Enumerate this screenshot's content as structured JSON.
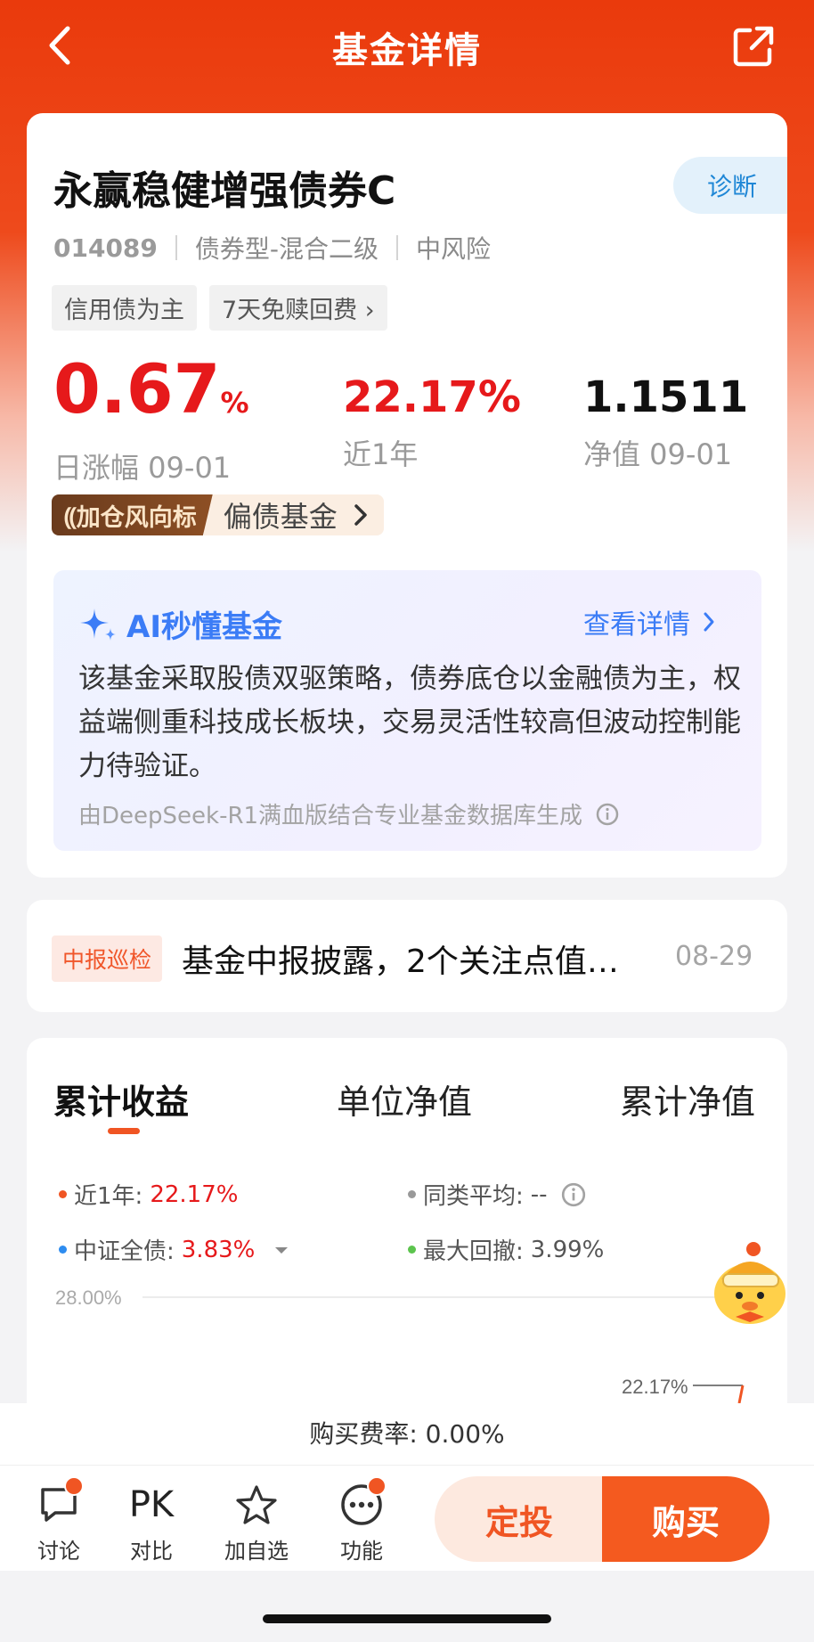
{
  "header": {
    "title": "基金详情",
    "back_icon": "chevron-left-icon",
    "share_icon": "share-icon"
  },
  "fund": {
    "name": "永赢稳健增强债券C",
    "diagnose_label": "诊断",
    "code": "014089",
    "category": "债券型-混合二级",
    "risk": "中风险",
    "tags": [
      "信用债为主",
      "7天免赎回费"
    ],
    "daily_change": {
      "value": "0.67",
      "unit": "%",
      "label": "日涨幅 09-01"
    },
    "year_return": {
      "value": "22.17%",
      "label": "近1年"
    },
    "nav": {
      "value": "1.1511",
      "label": "净值 09-01"
    },
    "windvane": {
      "badge": "加仓风向标",
      "text": "偏债基金"
    }
  },
  "ai": {
    "title": "AI秒懂基金",
    "detail_link": "查看详情",
    "body": "该基金采取股债双驱策略，债券底仓以金融债为主，权益端侧重科技成长板块，交易灵活性较高但波动控制能力待验证。",
    "source": "由DeepSeek-R1满血版结合专业基金数据库生成"
  },
  "report": {
    "tag": "中报巡检",
    "title": "基金中报披露，2个关注点值…",
    "date": "08-29"
  },
  "chart_tabs": [
    "累计收益",
    "单位净值",
    "累计净值"
  ],
  "legend": {
    "year_label": "近1年:",
    "year_value": "22.17%",
    "peer_label": "同类平均:",
    "peer_value": "--",
    "bench_label": "中证全债:",
    "bench_value": "3.83%",
    "drawdown_label": "最大回撤:",
    "drawdown_value": "3.99%"
  },
  "chart_data": {
    "type": "line",
    "y_tick_labels": [
      "28.00%"
    ],
    "annotations": [
      "22.17%"
    ],
    "series": [
      {
        "name": "近1年",
        "last_value": 22.17
      }
    ],
    "grid": true
  },
  "fee": {
    "label": "购买费率: 0.00%"
  },
  "nav_bar": {
    "items": [
      {
        "label": "讨论",
        "icon": "chat-icon"
      },
      {
        "label": "对比",
        "icon": "PK"
      },
      {
        "label": "加自选",
        "icon": "star-icon"
      },
      {
        "label": "功能",
        "icon": "more-icon"
      }
    ],
    "sip_label": "定投",
    "buy_label": "购买"
  },
  "colors": {
    "brand": "#ea3a0c",
    "up": "#e6191b",
    "ai": "#3b7cf6",
    "buy": "#f45a1f"
  }
}
